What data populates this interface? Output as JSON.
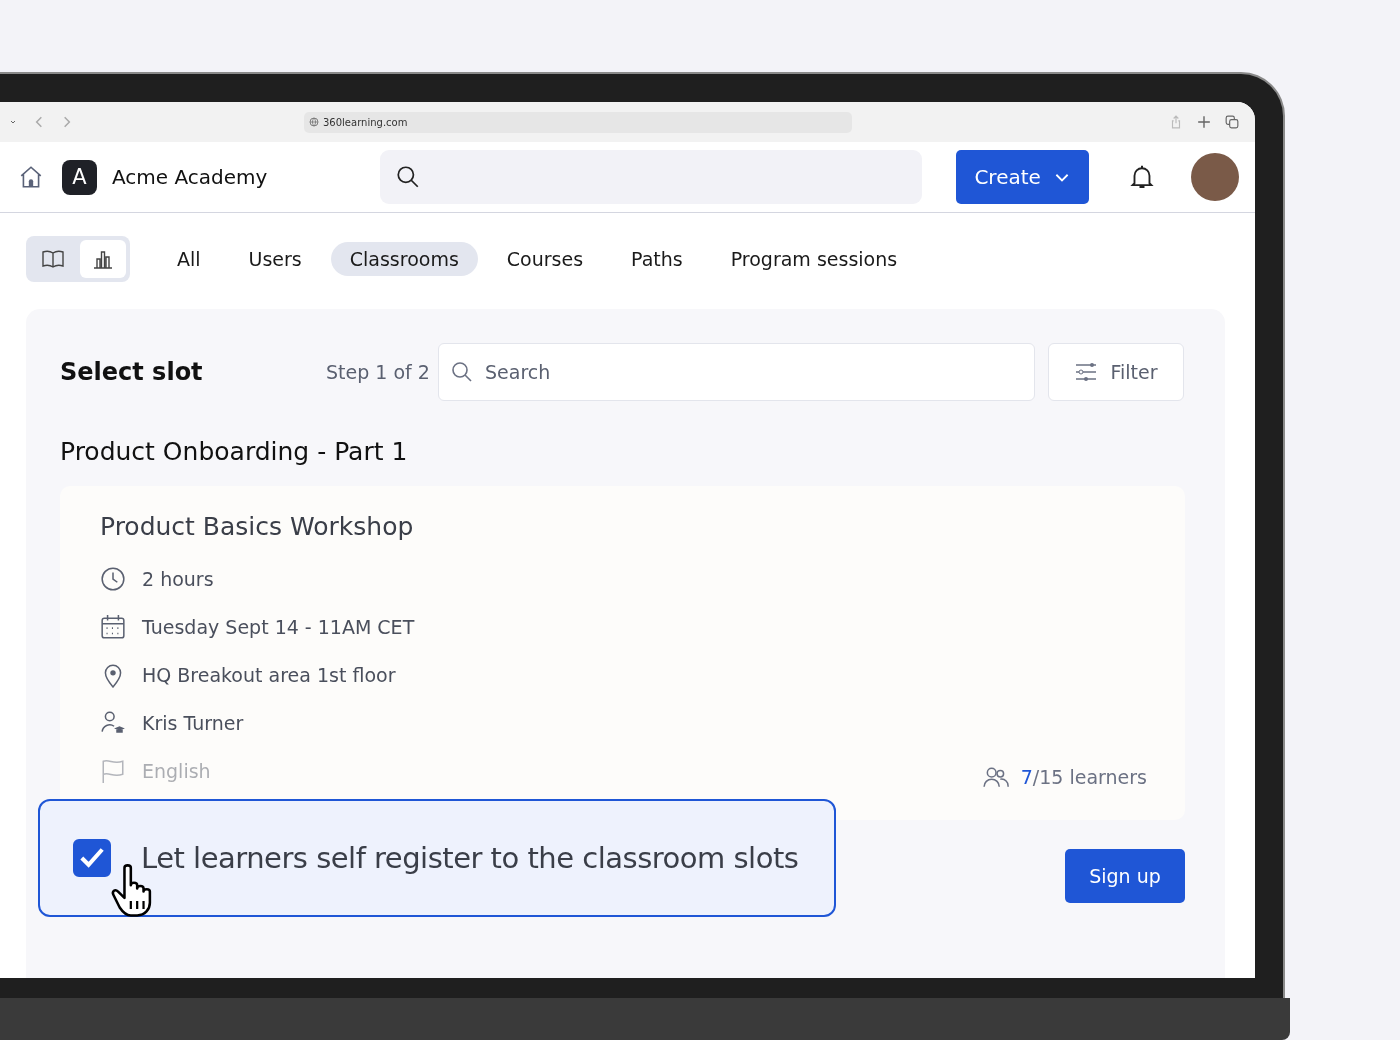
{
  "browser": {
    "url": "360learning.com"
  },
  "header": {
    "org_initial": "A",
    "org_name": "Acme Academy",
    "create_label": "Create"
  },
  "tabs": [
    {
      "label": "All",
      "selected": false
    },
    {
      "label": "Users",
      "selected": false
    },
    {
      "label": "Classrooms",
      "selected": true
    },
    {
      "label": "Courses",
      "selected": false
    },
    {
      "label": "Paths",
      "selected": false
    },
    {
      "label": "Program sessions",
      "selected": false
    }
  ],
  "view_toggle": [
    {
      "kind": "book",
      "selected": false
    },
    {
      "kind": "chart",
      "selected": true
    }
  ],
  "panel": {
    "title": "Select slot",
    "step": "Step 1 of 2",
    "search_placeholder": "Search",
    "filter_label": "Filter",
    "section_title": "Product Onboarding - Part 1"
  },
  "session": {
    "title": "Product Basics Workshop",
    "details": [
      {
        "kind": "clock",
        "text": "2 hours"
      },
      {
        "kind": "calendar",
        "text": "Tuesday Sept 14 - 11AM CET"
      },
      {
        "kind": "pin",
        "text": "HQ Breakout area 1st floor"
      },
      {
        "kind": "trainer",
        "text": "Kris Turner"
      },
      {
        "kind": "flag",
        "text": "English"
      }
    ],
    "learners_count": "7",
    "learners_capacity": "/15 learners"
  },
  "signup_label": "Sign up",
  "callout": {
    "label": "Let learners self register to the classroom slots",
    "checked": true
  }
}
